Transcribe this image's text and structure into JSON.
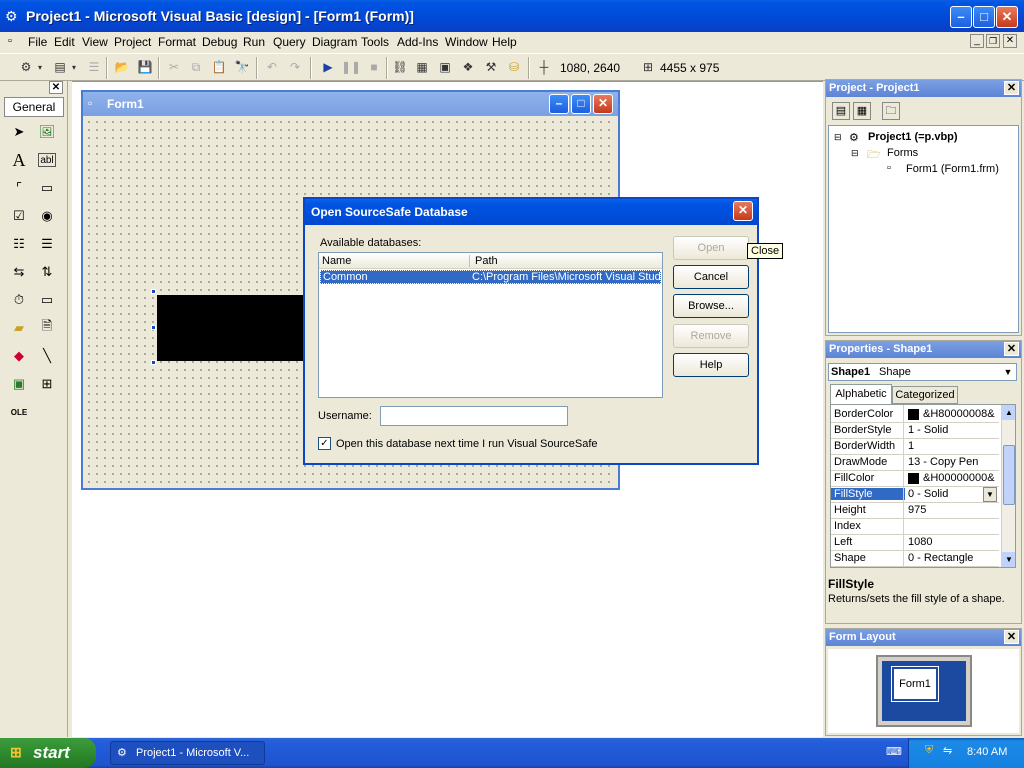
{
  "titlebar": {
    "title": "Project1 - Microsoft Visual Basic [design] - [Form1 (Form)]"
  },
  "menu": [
    "File",
    "Edit",
    "View",
    "Project",
    "Format",
    "Debug",
    "Run",
    "Query",
    "Diagram",
    "Tools",
    "Add-Ins",
    "Window",
    "Help"
  ],
  "toolbar": {
    "position": "1080, 2640",
    "size": "4455 x 975"
  },
  "toolbox": {
    "tab_label": "General"
  },
  "form1": {
    "title": "Form1"
  },
  "dialog": {
    "title": "Open SourceSafe Database",
    "available_label": "Available databases:",
    "columns": [
      "Name",
      "Path"
    ],
    "rows": [
      {
        "name": "Common",
        "path": "C:\\Program Files\\Microsoft Visual Studio"
      }
    ],
    "username_label": "Username:",
    "username_value": "",
    "checkbox_label": "Open this database next time I run Visual SourceSafe",
    "checkbox_checked": true,
    "buttons": {
      "open": "Open",
      "cancel": "Cancel",
      "browse": "Browse...",
      "remove": "Remove",
      "help": "Help"
    },
    "tooltip": "Close"
  },
  "project_panel": {
    "title": "Project - Project1",
    "root": "Project1 (=p.vbp)",
    "folder": "Forms",
    "item": "Form1 (Form1.frm)"
  },
  "properties_panel": {
    "title": "Properties - Shape1",
    "object_name": "Shape1",
    "object_type": "Shape",
    "tabs": [
      "Alphabetic",
      "Categorized"
    ],
    "rows": [
      {
        "name": "BorderColor",
        "value": "&H80000008&",
        "swatch": "#000000"
      },
      {
        "name": "BorderStyle",
        "value": "1 - Solid"
      },
      {
        "name": "BorderWidth",
        "value": "1"
      },
      {
        "name": "DrawMode",
        "value": "13 - Copy Pen"
      },
      {
        "name": "FillColor",
        "value": "&H00000000&",
        "swatch": "#000000"
      },
      {
        "name": "FillStyle",
        "value": "0 - Solid",
        "selected": true
      },
      {
        "name": "Height",
        "value": "975"
      },
      {
        "name": "Index",
        "value": ""
      },
      {
        "name": "Left",
        "value": "1080"
      },
      {
        "name": "Shape",
        "value": "0 - Rectangle"
      }
    ],
    "desc_title": "FillStyle",
    "desc_text": "Returns/sets the fill style of a shape."
  },
  "form_layout": {
    "title": "Form Layout",
    "form_label": "Form1"
  },
  "taskbar": {
    "start": "start",
    "task": "Project1 - Microsoft V...",
    "clock": "8:40 AM"
  },
  "colors": {
    "xp_blue": "#0054e3",
    "selection": "#316ac5",
    "shape_fill": "#000000"
  }
}
